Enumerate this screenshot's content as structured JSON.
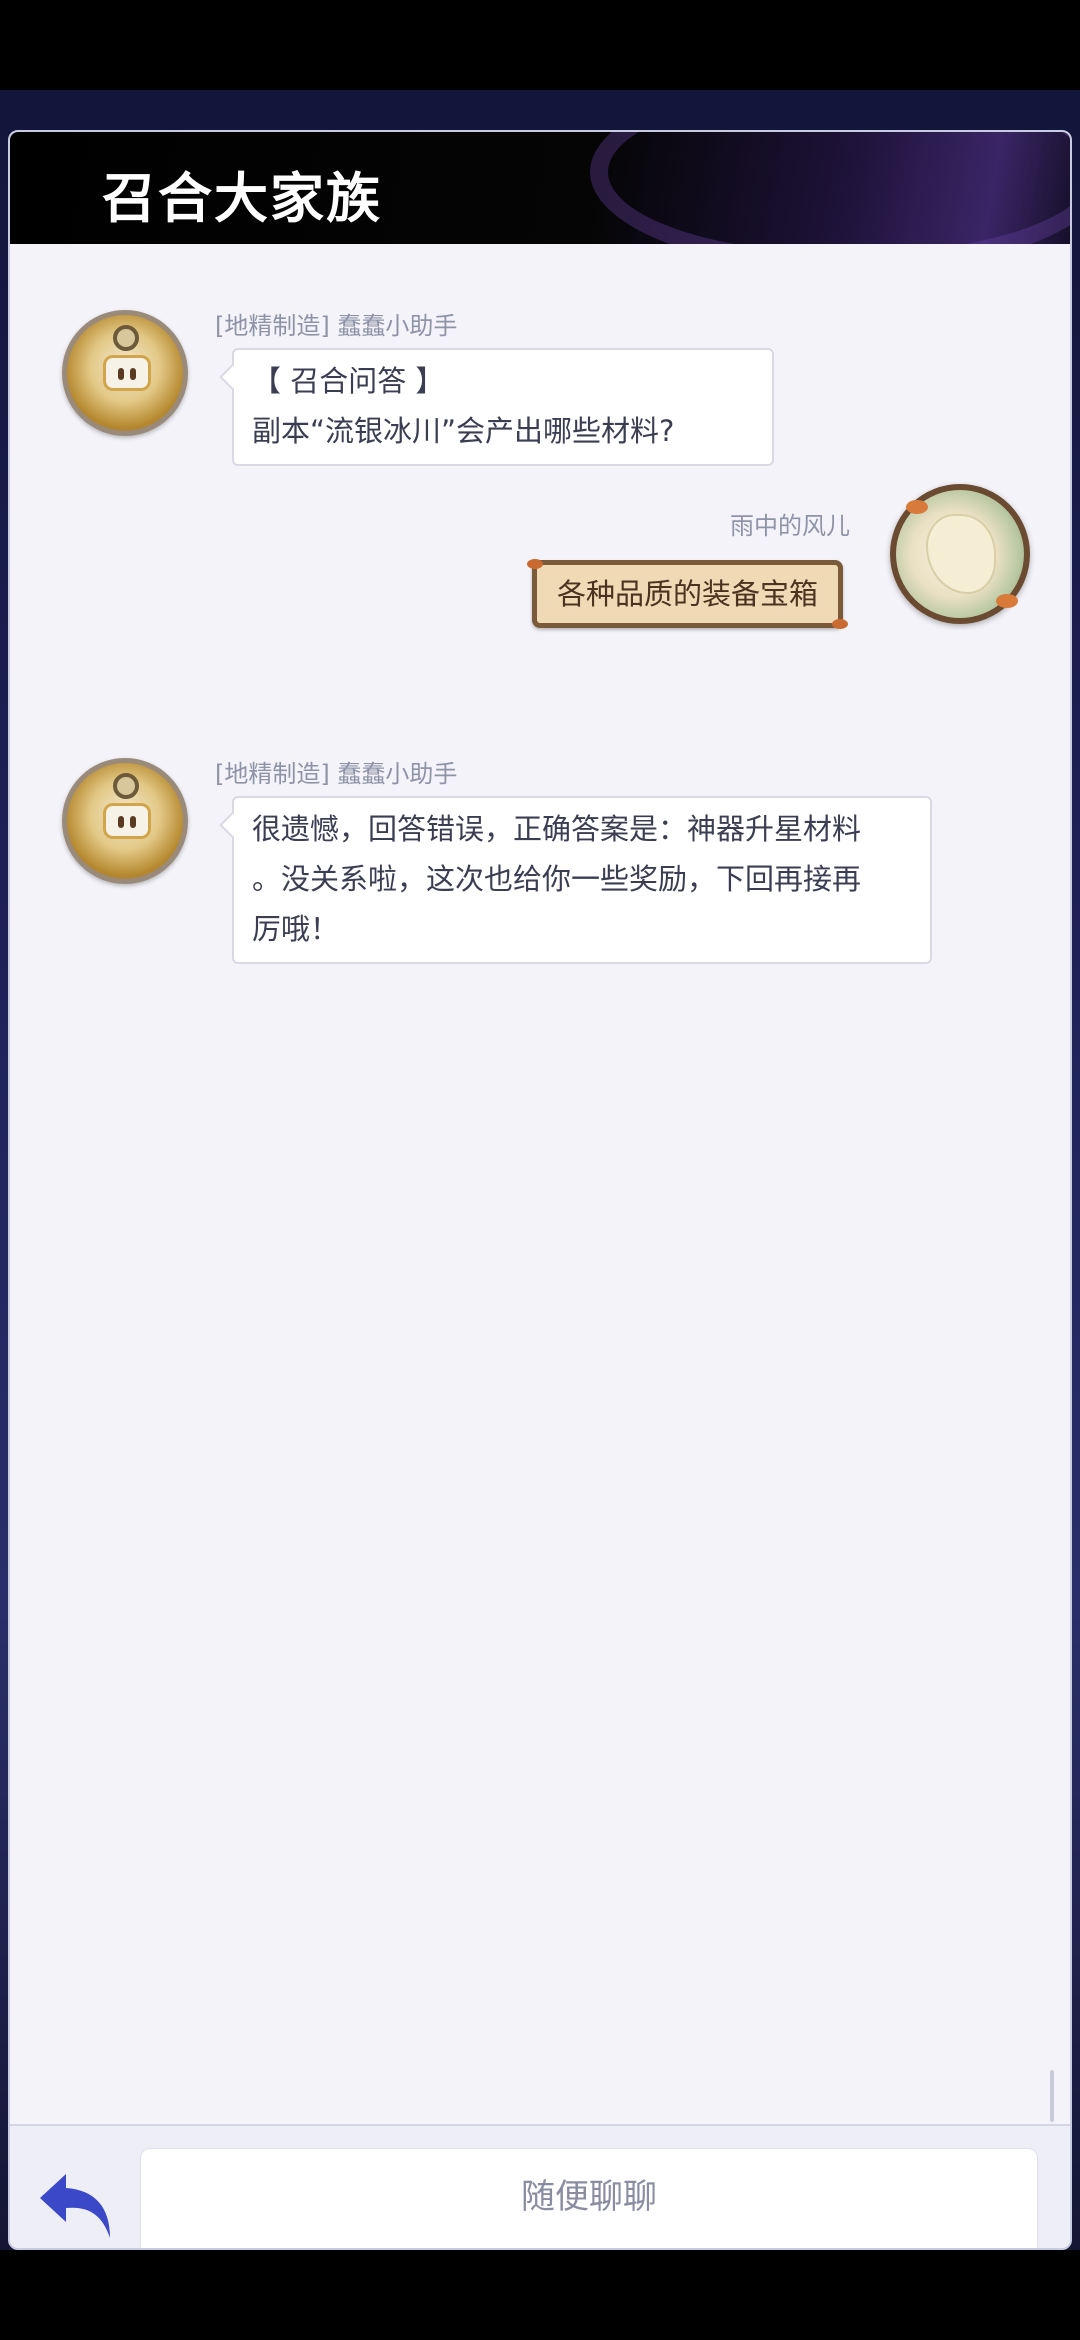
{
  "header": {
    "title": "召合大家族"
  },
  "messages": [
    {
      "sender": "[地精制造] 蠢蠢小助手",
      "avatar_icon": "gnome-robot-avatar",
      "lines": [
        "【 召合问答 】",
        "副本“流银冰川”会产出哪些材料?"
      ]
    },
    {
      "sender": "雨中的风儿",
      "avatar_icon": "white-haired-elf-avatar",
      "text": "各种品质的装备宝箱"
    },
    {
      "sender": "[地精制造] 蠢蠢小助手",
      "avatar_icon": "gnome-robot-avatar",
      "lines": [
        "很遗憾，回答错误，正确答案是：神器升星材料",
        "。没关系啦，这次也给你一些奖励，下回再接再",
        "厉哦！"
      ]
    }
  ],
  "input": {
    "placeholder": "随便聊聊"
  },
  "colors": {
    "header_bg": "#000000",
    "panel_bg": "#f1f1f8",
    "user_bubble": "#f0d9b5",
    "back_icon": "#3b48c8"
  }
}
